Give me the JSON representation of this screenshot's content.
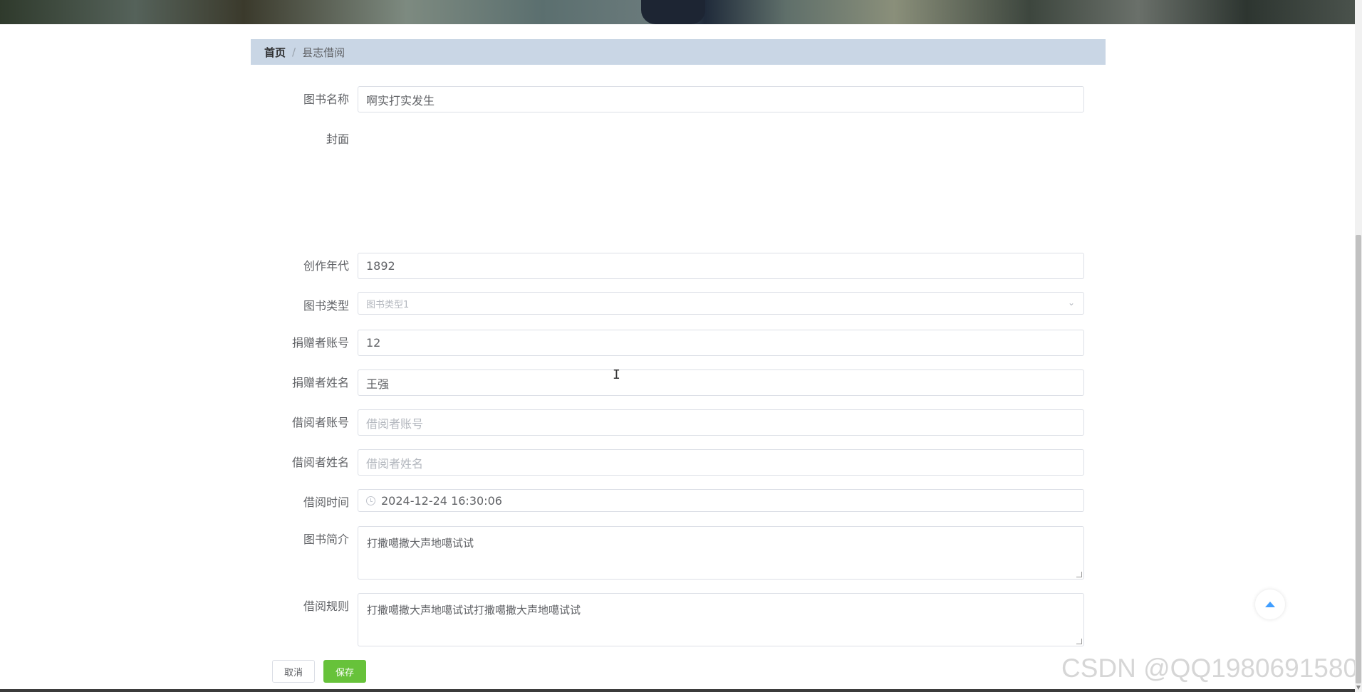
{
  "breadcrumb": {
    "home": "首页",
    "separator": "/",
    "current": "县志借阅"
  },
  "form": {
    "book_name": {
      "label": "图书名称",
      "value": "啊实打实发生"
    },
    "cover": {
      "label": "封面"
    },
    "year": {
      "label": "创作年代",
      "value": "1892"
    },
    "book_type": {
      "label": "图书类型",
      "value": "图书类型1"
    },
    "donor_account": {
      "label": "捐赠者账号",
      "value": "12"
    },
    "donor_name": {
      "label": "捐赠者姓名",
      "value": "王强"
    },
    "borrower_account": {
      "label": "借阅者账号",
      "placeholder": "借阅者账号"
    },
    "borrower_name": {
      "label": "借阅者姓名",
      "placeholder": "借阅者姓名"
    },
    "borrow_time": {
      "label": "借阅时间",
      "value": "2024-12-24 16:30:06"
    },
    "intro": {
      "label": "图书简介",
      "value": "打撒噶撒大声地噶试试"
    },
    "rules": {
      "label": "借阅规则",
      "value": "打撒噶撒大声地噶试试打撒噶撒大声地噶试试"
    }
  },
  "buttons": {
    "cancel": "取消",
    "save": "保存"
  },
  "watermark": "CSDN @QQ1980691580",
  "colors": {
    "breadcrumb_bg": "#c9d6e5",
    "save_button": "#67c23a",
    "backtop_icon": "#409eff"
  },
  "icons": {
    "select_arrow": "chevron-down-icon",
    "time": "clock-icon",
    "backtop": "caret-up-icon",
    "cursor": "text-cursor-icon"
  }
}
